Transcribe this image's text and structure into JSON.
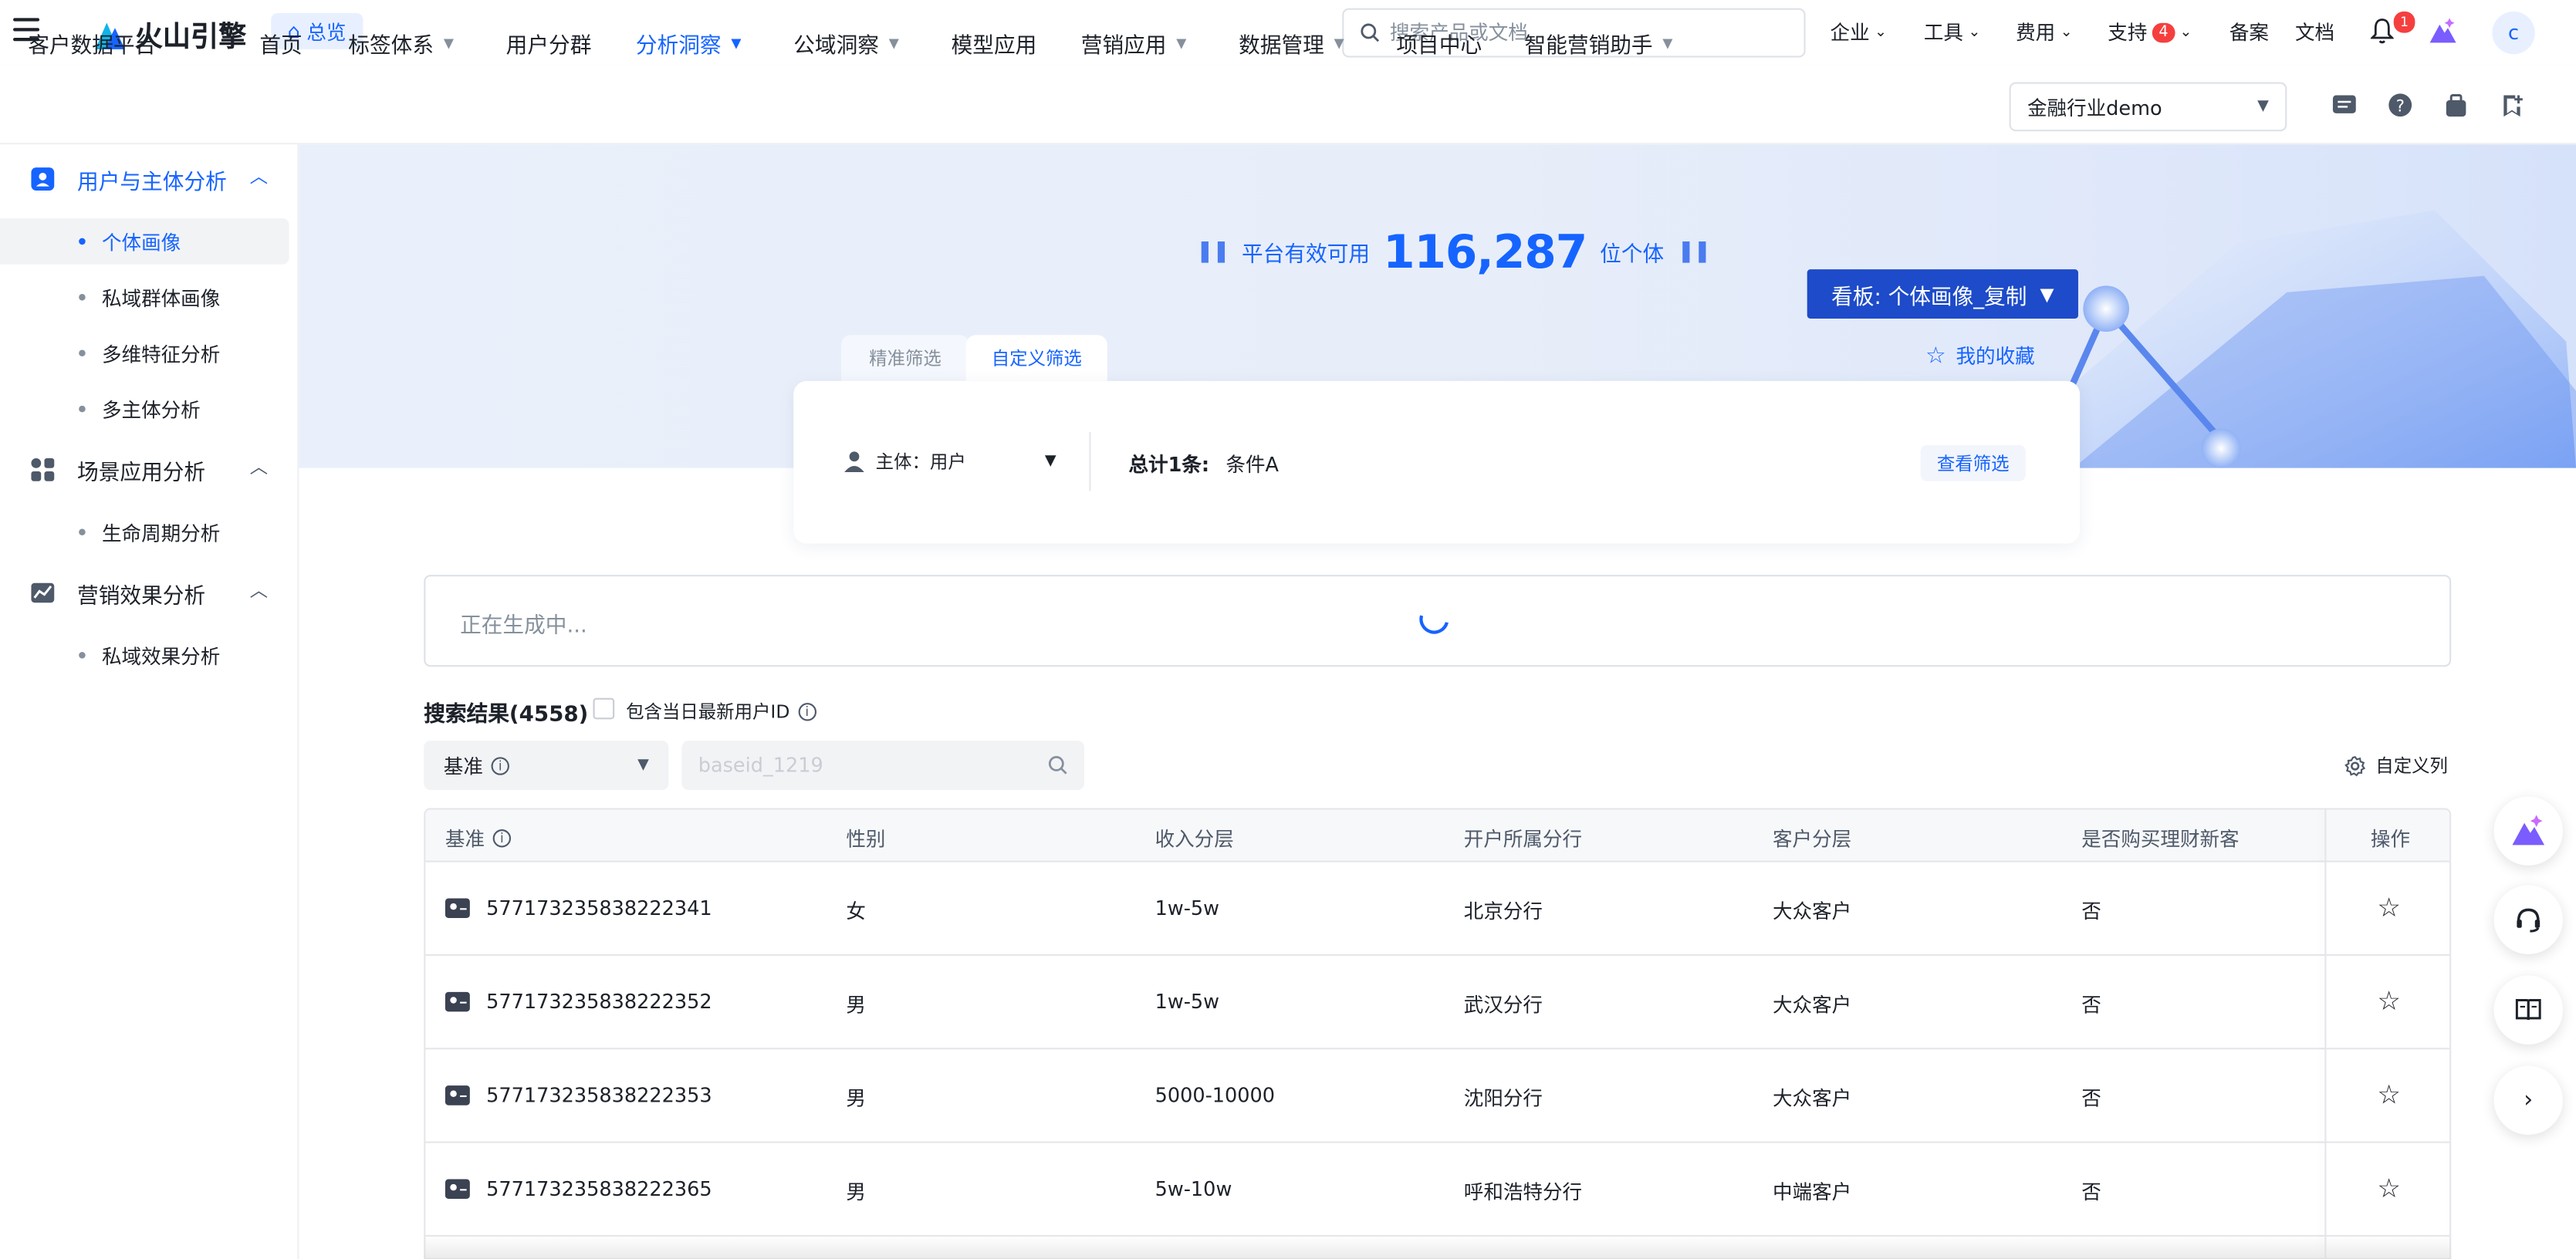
{
  "header": {
    "logo_text": "火山引擎",
    "overview_label": "总览",
    "search_placeholder": "搜索产品或文档",
    "links": [
      {
        "label": "企业"
      },
      {
        "label": "工具"
      },
      {
        "label": "费用"
      },
      {
        "label": "支持",
        "badge": "4"
      },
      {
        "label": "备案"
      },
      {
        "label": "文档"
      }
    ],
    "notification_count": "1",
    "avatar_letter": "c"
  },
  "navbar": {
    "platform_name": "客户数据平台",
    "items": [
      {
        "label": "首页"
      },
      {
        "label": "标签体系"
      },
      {
        "label": "用户分群"
      },
      {
        "label": "分析洞察",
        "active": true
      },
      {
        "label": "公域洞察"
      },
      {
        "label": "模型应用"
      },
      {
        "label": "营销应用"
      },
      {
        "label": "数据管理"
      },
      {
        "label": "项目中心"
      },
      {
        "label": "智能营销助手"
      }
    ],
    "tenant": "金融行业demo"
  },
  "sidebar": {
    "groups": [
      {
        "label": "用户与主体分析",
        "active": true,
        "icon": "user-card-icon",
        "items": [
          {
            "label": "个体画像",
            "active": true
          },
          {
            "label": "私域群体画像"
          },
          {
            "label": "多维特征分析"
          },
          {
            "label": "多主体分析"
          }
        ]
      },
      {
        "label": "场景应用分析",
        "icon": "grid-icon",
        "items": [
          {
            "label": "生命周期分析"
          }
        ]
      },
      {
        "label": "营销效果分析",
        "icon": "chart-icon",
        "items": [
          {
            "label": "私域效果分析"
          }
        ]
      }
    ]
  },
  "hero": {
    "prefix": "平台有效可用",
    "count": "116,287",
    "suffix": "位个体",
    "board_button": "看板: 个体画像_复制",
    "favorites": "我的收藏",
    "tabs": [
      "精准筛选",
      "自定义筛选"
    ]
  },
  "filter": {
    "subject": "主体：用户",
    "total_label": "总计1条:",
    "total_value": "条件A",
    "view_button": "查看筛选"
  },
  "generating": "正在生成中...",
  "results": {
    "title": "搜索结果(4558)",
    "include_today": "包含当日最新用户ID",
    "select_value": "基准",
    "id_placeholder": "baseid_1219",
    "custom_columns": "自定义列",
    "columns": [
      "基准",
      "性别",
      "收入分层",
      "开户所属分行",
      "客户分层",
      "是否购买理财新客",
      "操作"
    ],
    "rows": [
      [
        "577173235838222341",
        "女",
        "1w-5w",
        "北京分行",
        "大众客户",
        "否"
      ],
      [
        "577173235838222352",
        "男",
        "1w-5w",
        "武汉分行",
        "大众客户",
        "否"
      ],
      [
        "577173235838222353",
        "男",
        "5000-10000",
        "沈阳分行",
        "大众客户",
        "否"
      ],
      [
        "577173235838222365",
        "男",
        "5w-10w",
        "呼和浩特分行",
        "中端客户",
        "否"
      ]
    ]
  },
  "colors": {
    "accent": "#1664ff",
    "board_button": "#1d4bc9",
    "badge": "#f53f3f"
  }
}
